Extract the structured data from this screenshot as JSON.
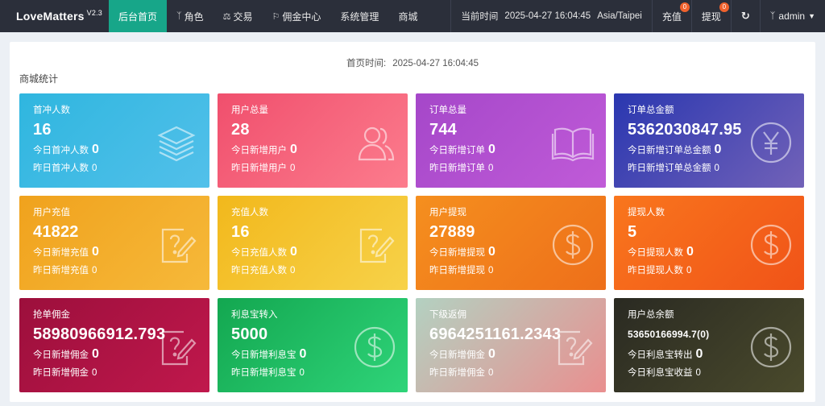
{
  "topbar": {
    "brand": "LoveMatters",
    "version": "V2.3",
    "nav": [
      {
        "label": "后台首页",
        "icon": ""
      },
      {
        "label": "角色",
        "icon": "person-icon"
      },
      {
        "label": "交易",
        "icon": "scale-icon"
      },
      {
        "label": "佣金中心",
        "icon": "flag-icon"
      },
      {
        "label": "系统管理",
        "icon": ""
      },
      {
        "label": "商城",
        "icon": ""
      }
    ],
    "time_label": "当前时间",
    "time_value": "2025-04-27 16:04:45",
    "timezone": "Asia/Taipei",
    "recharge": "充值",
    "recharge_badge": "0",
    "withdraw": "提现",
    "withdraw_badge": "0",
    "refresh_glyph": "↻",
    "user": "admin",
    "user_icon": "person-icon",
    "dropdown_icon": "chevron-down-icon"
  },
  "main": {
    "home_time_label": "首页时间:",
    "home_time_value": "2025-04-27 16:04:45",
    "section_title": "商城统计"
  },
  "cards": [
    {
      "title": "首冲人数",
      "value": "16",
      "sub_label": "今日首冲人数",
      "sub_value": "0",
      "sub2_label": "昨日首冲人数",
      "sub2_value": "0",
      "icon": "stack-icon",
      "color": "#2fb6df"
    },
    {
      "title": "用户总量",
      "value": "28",
      "sub_label": "今日新增用户",
      "sub_value": "0",
      "sub2_label": "昨日新增用户",
      "sub2_value": "0",
      "icon": "users-icon",
      "color": "#f04f6d"
    },
    {
      "title": "订单总量",
      "value": "744",
      "sub_label": "今日新增订单",
      "sub_value": "0",
      "sub2_label": "昨日新增订单",
      "sub2_value": "0",
      "icon": "book-icon",
      "color": "#a547c9"
    },
    {
      "title": "订单总金额",
      "value": "5362030847.95",
      "sub_label": "今日新增订单总金额",
      "sub_value": "0",
      "sub2_label": "昨日新增订单总金额",
      "sub2_value": "0",
      "icon": "yen-icon",
      "color": "#2a37b0"
    },
    {
      "title": "用户充值",
      "value": "41822",
      "sub_label": "今日新增充值",
      "sub_value": "0",
      "sub2_label": "昨日新增充值",
      "sub2_value": "0",
      "icon": "question-edit-icon",
      "color": "#f0a21d"
    },
    {
      "title": "充值人数",
      "value": "16",
      "sub_label": "今日充值人数",
      "sub_value": "0",
      "sub2_label": "昨日充值人数",
      "sub2_value": "0",
      "icon": "question-edit-icon",
      "color": "#f2b81c"
    },
    {
      "title": "用户提现",
      "value": "27889",
      "sub_label": "今日新增提现",
      "sub_value": "0",
      "sub2_label": "昨日新增提现",
      "sub2_value": "0",
      "icon": "dollar-icon",
      "color": "#f58f1e"
    },
    {
      "title": "提现人数",
      "value": "5",
      "sub_label": "今日提现人数",
      "sub_value": "0",
      "sub2_label": "昨日提现人数",
      "sub2_value": "0",
      "icon": "dollar-icon",
      "color": "#f9761d"
    },
    {
      "title": "抢单佣金",
      "value": "58980966912.793",
      "sub_label": "今日新增佣金",
      "sub_value": "0",
      "sub2_label": "昨日新增佣金",
      "sub2_value": "0",
      "icon": "question-edit-icon",
      "color": "#9c0f3c"
    },
    {
      "title": "利息宝转入",
      "value": "5000",
      "sub_label": "今日新增利息宝",
      "sub_value": "0",
      "sub2_label": "昨日新增利息宝",
      "sub2_value": "0",
      "icon": "dollar-icon",
      "color": "#13a750"
    },
    {
      "title": "下级返佣",
      "value": "6964251161.2343",
      "sub_label": "今日新增佣金",
      "sub_value": "0",
      "sub2_label": "昨日新增佣金",
      "sub2_value": "0",
      "icon": "question-edit-icon",
      "color": "#b3d1c1"
    },
    {
      "title": "用户总余额",
      "value": "53650166994.7(0)",
      "sub_label": "今日利息宝转出",
      "sub_value": "0",
      "sub2_label": "今日利息宝收益",
      "sub2_value": "0",
      "icon": "dollar-icon",
      "color": "#2a2a22"
    }
  ]
}
